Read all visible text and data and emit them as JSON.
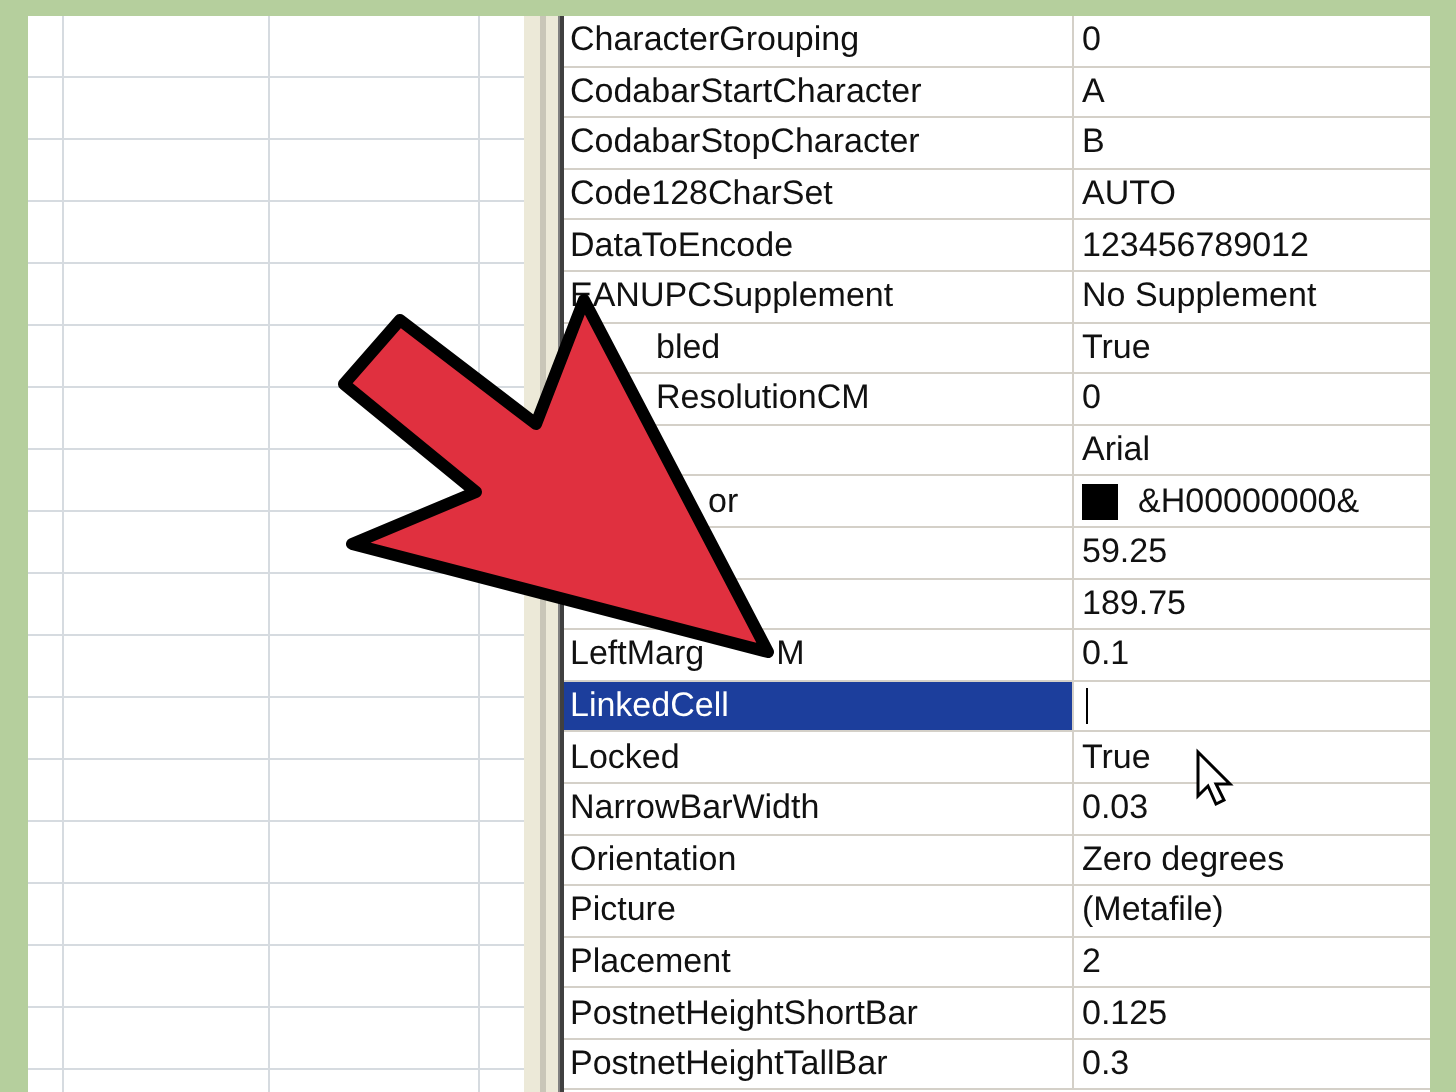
{
  "properties": [
    {
      "kind": "plain",
      "name": "CharacterGrouping",
      "value": "0",
      "selected": false
    },
    {
      "kind": "plain",
      "name": "CodabarStartCharacter",
      "value": "A",
      "selected": false
    },
    {
      "kind": "plain",
      "name": "CodabarStopCharacter",
      "value": "B",
      "selected": false
    },
    {
      "kind": "plain",
      "name": "Code128CharSet",
      "value": "AUTO",
      "selected": false
    },
    {
      "kind": "plain",
      "name": "DataToEncode",
      "value": "123456789012",
      "selected": false
    },
    {
      "kind": "plain",
      "name": "EANUPCSupplement",
      "value": "No Supplement",
      "selected": false
    },
    {
      "kind": "covered",
      "name": "bled",
      "value": "True",
      "selected": false
    },
    {
      "kind": "covered",
      "name": "ResolutionCM",
      "value": "0",
      "selected": false
    },
    {
      "kind": "covered",
      "value": "Arial",
      "selected": false
    },
    {
      "kind": "covered_far",
      "name": "or",
      "value": "&H00000000&",
      "color": "#000000",
      "selected": false
    },
    {
      "kind": "covered",
      "value": "59.25",
      "selected": false
    },
    {
      "kind": "covered",
      "value": "189.75",
      "selected": false
    },
    {
      "kind": "split",
      "name": "LeftMarg",
      "name_tail": "M",
      "value": "0.1",
      "selected": false
    },
    {
      "kind": "plain",
      "name": "LinkedCell",
      "selected": true
    },
    {
      "kind": "plain",
      "name": "Locked",
      "value": "True",
      "selected": false
    },
    {
      "kind": "plain",
      "name": "NarrowBarWidth",
      "value": "0.03",
      "selected": false
    },
    {
      "kind": "plain",
      "name": "Orientation",
      "value": "Zero degrees",
      "selected": false
    },
    {
      "kind": "plain",
      "name": "Picture",
      "value": "(Metafile)",
      "selected": false
    },
    {
      "kind": "plain",
      "name": "Placement",
      "value": "2",
      "selected": false
    },
    {
      "kind": "plain",
      "name": "PostnetHeightShortBar",
      "value": "0.125",
      "selected": false
    },
    {
      "kind": "plain",
      "name": "PostnetHeightTallBar",
      "value": "0.3",
      "selected": false
    }
  ]
}
